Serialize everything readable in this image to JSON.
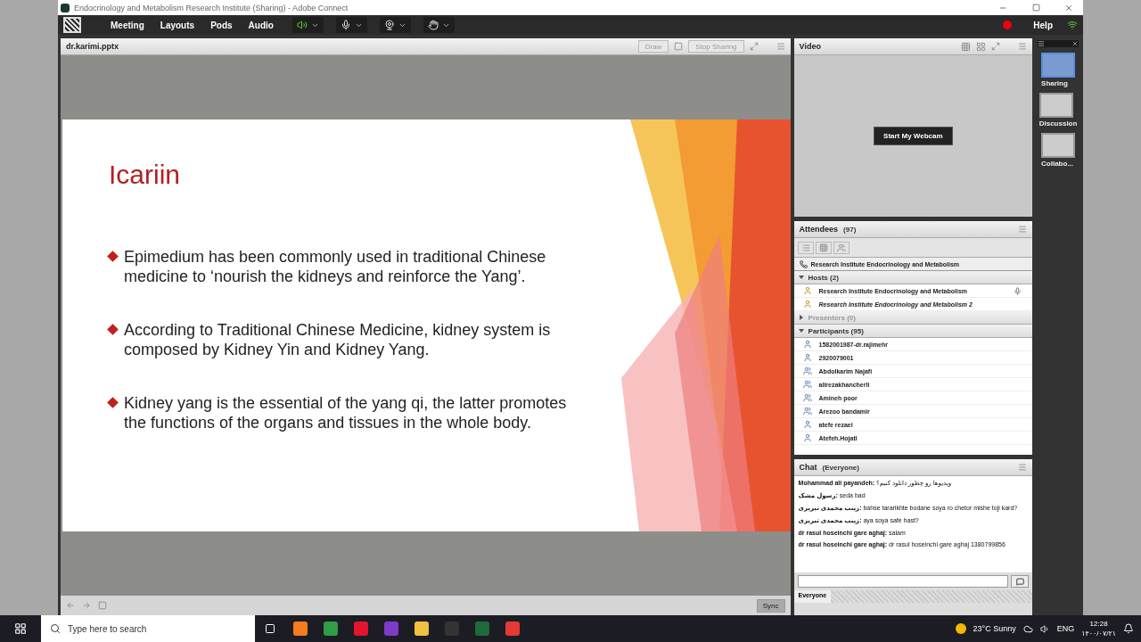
{
  "window": {
    "title": "Endocrinology and Metabolism Research Institute (Sharing) - Adobe Connect"
  },
  "menu": [
    "Meeting",
    "Layouts",
    "Pods",
    "Audio"
  ],
  "toolbar": {
    "speaker_on": true,
    "recording": true
  },
  "help": "Help",
  "share_pod": {
    "title": "dr.karimi.pptx",
    "draw": "Draw",
    "stop": "Stop Sharing",
    "sync": "Sync",
    "slide": {
      "title": "Icariin",
      "bullets": [
        "Epimedium has been commonly used in traditional Chinese medicine to ‘nourish the kidneys and reinforce the Yang’.",
        " According to Traditional Chinese Medicine, kidney system is composed by Kidney Yin and Kidney Yang.",
        " Kidney yang is the essential of the yang qi, the latter promotes the functions of the organs and tissues in the whole body."
      ]
    }
  },
  "video_pod": {
    "title": "Video",
    "button": "Start My Webcam"
  },
  "attendees": {
    "title": "Attendees",
    "count": "(97)",
    "owner": "Research Institute  Endocrinology and Metabolism",
    "groups": [
      {
        "label": "Hosts (2)",
        "expanded": true,
        "children": [
          {
            "name": "Research Institute  Endocrinology and Metabolism",
            "kind": "host",
            "current": false,
            "speaking": true
          },
          {
            "name": "Research Institute  Endocrinology and Metabolism  2",
            "kind": "host",
            "current": true,
            "speaking": false
          }
        ]
      },
      {
        "label": "Presenters (0)",
        "expanded": false
      },
      {
        "label": "Participants (95)",
        "expanded": true,
        "children": [
          {
            "name": "1582001987-dr.rajimehr",
            "kind": "user",
            "current": false,
            "speaking": false
          },
          {
            "name": "2920079001",
            "kind": "user",
            "current": false,
            "speaking": false
          },
          {
            "name": "Abdolkarim Najafi",
            "kind": "guest",
            "current": false,
            "speaking": false
          },
          {
            "name": "alirezakhancherli",
            "kind": "guest",
            "current": false,
            "speaking": false
          },
          {
            "name": "Amineh poor",
            "kind": "guest",
            "current": false,
            "speaking": false
          },
          {
            "name": "Arezoo  bandamir",
            "kind": "guest",
            "current": false,
            "speaking": false
          },
          {
            "name": "atefe rezaei",
            "kind": "user",
            "current": false,
            "speaking": false
          },
          {
            "name": "Atefeh.Hojati",
            "kind": "user",
            "current": false,
            "speaking": false
          }
        ]
      }
    ]
  },
  "chat": {
    "title": "Chat",
    "scope": "(Everyone)",
    "tab": "Everyone",
    "messages": [
      {
        "sender": "Mohammad ali payandeh:",
        "text": "ویدیوها رو چطور دانلود کنیم؟"
      },
      {
        "sender": "رسول مشک:",
        "text": "seda bad"
      },
      {
        "sender": "زینب محمدی تبریزی:",
        "text": "bahse tararikhte bodane soya  ro chetor mishe toji kard?"
      },
      {
        "sender": "زینب محمدی تبریزی:",
        "text": " aya soya safe hast?"
      },
      {
        "sender": "dr rasul hoseinchi gare aghaj:",
        "text": "salam"
      },
      {
        "sender": "dr rasul hoseinchi gare aghaj:",
        "text": "dr rasul hoseinchi gare aghaj 1380799856"
      }
    ]
  },
  "layouts": [
    {
      "label": "Sharing",
      "selected": true
    },
    {
      "label": "Discussion",
      "selected": false
    },
    {
      "label": "Collabo...",
      "selected": false
    }
  ],
  "taskbar": {
    "search_placeholder": "Type here to search",
    "weather": "23°C  Sunny",
    "lang": "ENG",
    "time": "12:28",
    "date": "۱۴۰۰/۰۷/۲۱"
  }
}
